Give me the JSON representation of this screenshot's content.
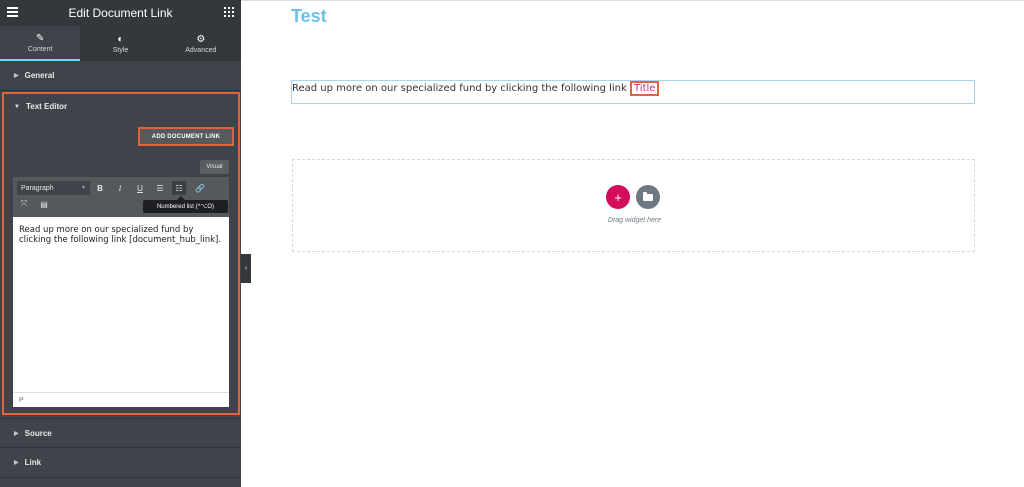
{
  "sidebar": {
    "title": "Edit Document Link",
    "tabs": [
      {
        "label": "Content",
        "icon": "pencil-icon"
      },
      {
        "label": "Style",
        "icon": "half-circle-icon"
      },
      {
        "label": "Advanced",
        "icon": "gear-icon"
      }
    ],
    "sections": {
      "general": "General",
      "text_editor": "Text Editor",
      "source": "Source",
      "link": "Link"
    },
    "add_document_link_label": "ADD DOCUMENT LINK",
    "visual_tab": "Visual",
    "toolbar": {
      "format_select": "Paragraph",
      "bold": "B",
      "italic": "I",
      "underline": "U"
    },
    "tooltip": "Numbered list (^⌥O)",
    "editor_text": "Read up more on our specialized fund by clicking the following link [document_hub_link].",
    "status_path": "P"
  },
  "canvas": {
    "page_title": "Test",
    "text_block": "Read up more on our specialized fund by clicking the following link ",
    "link_text": "Title",
    "drag_text": "Drag widget here",
    "add_symbol": "+"
  },
  "colors": {
    "accent": "#e0633a",
    "title_blue": "#6ec1e4",
    "add_button": "#d30c5c"
  }
}
